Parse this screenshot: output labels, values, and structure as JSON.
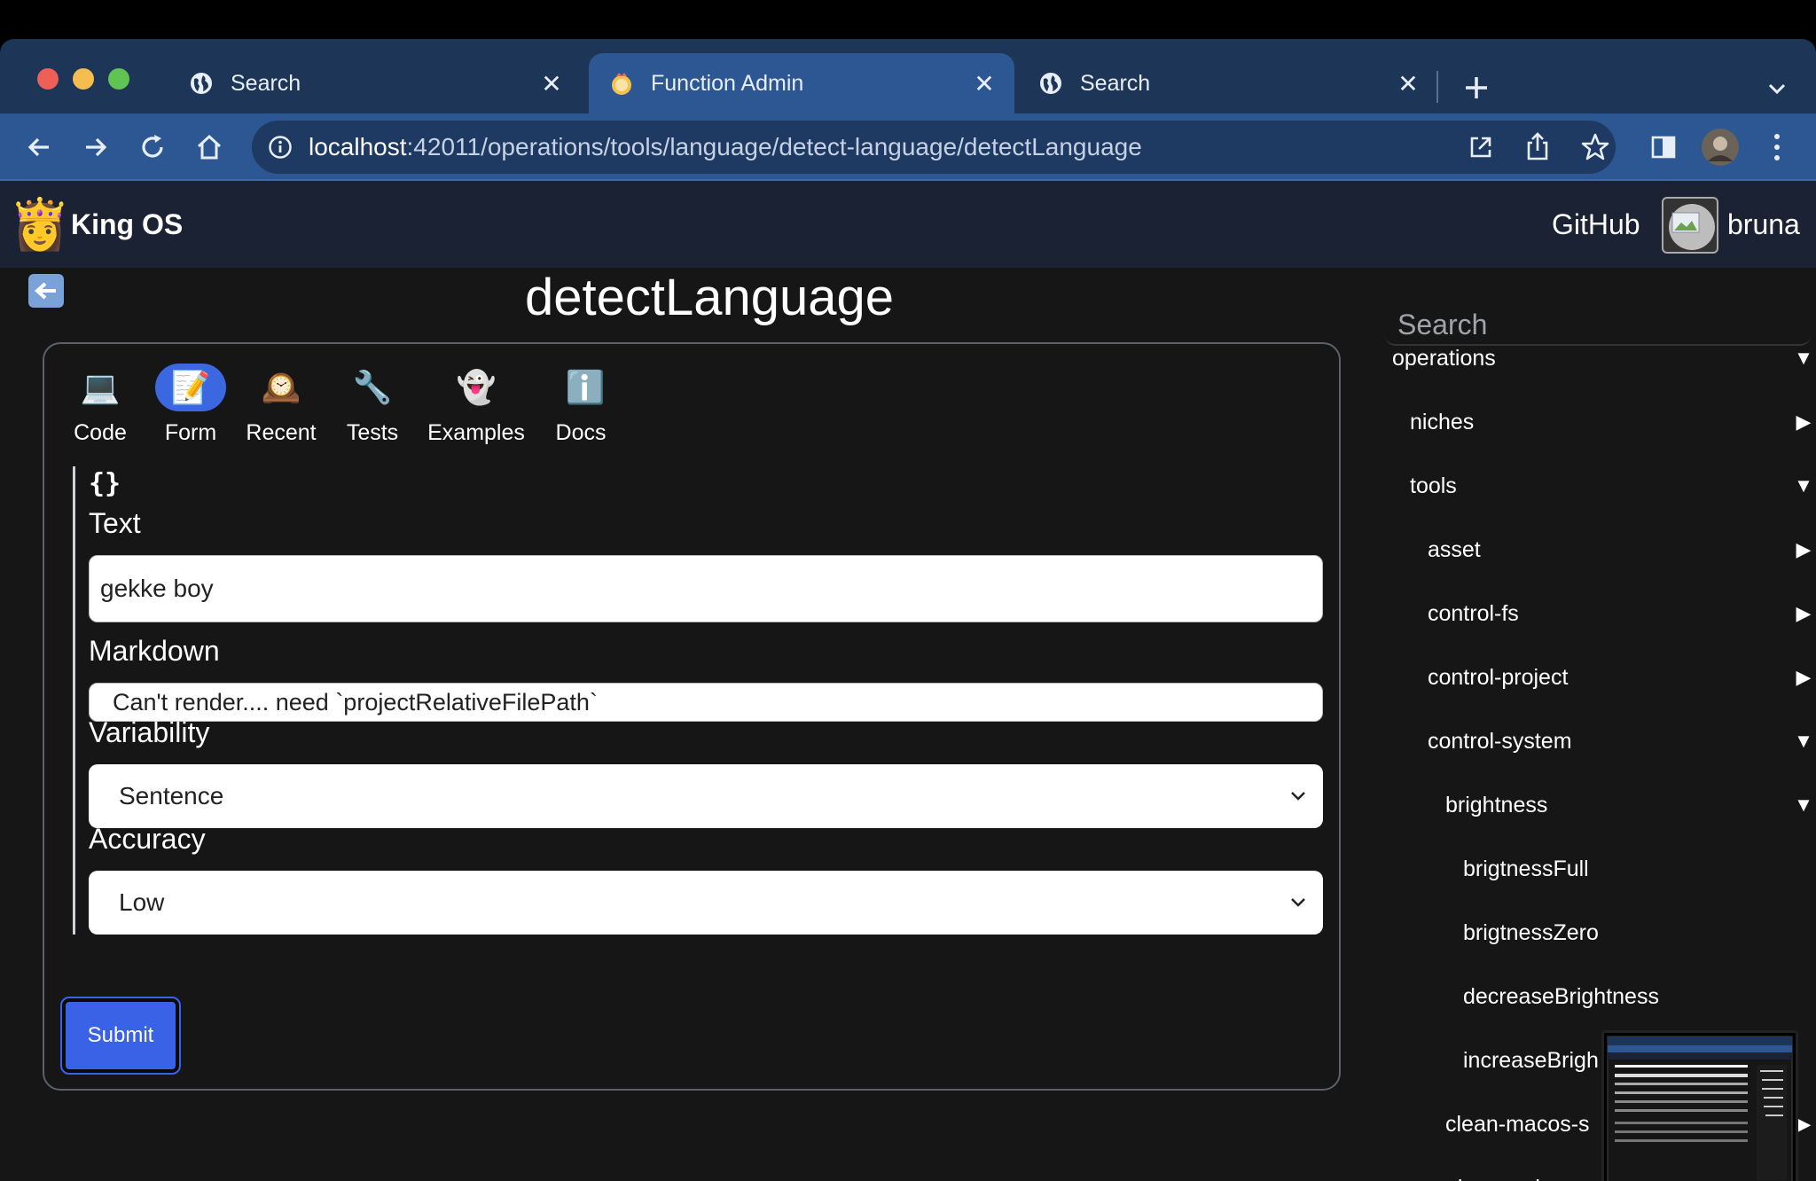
{
  "browser": {
    "tabs": [
      {
        "label": "Search",
        "favicon": "globe-icon"
      },
      {
        "label": "Function Admin",
        "favicon": "app-icon"
      },
      {
        "label": "Search",
        "favicon": "globe-icon"
      }
    ],
    "url_host": "localhost",
    "url_rest": ":42011/operations/tools/language/detect-language/detectLanguage"
  },
  "app": {
    "brand": "King OS",
    "brand_icon": "👸",
    "github": "GitHub",
    "username": "bruna"
  },
  "page": {
    "title": "detectLanguage"
  },
  "panel_tabs": [
    {
      "label": "Code",
      "icon": "💻"
    },
    {
      "label": "Form",
      "icon": "📝"
    },
    {
      "label": "Recent",
      "icon": "🕰️"
    },
    {
      "label": "Tests",
      "icon": "🔧"
    },
    {
      "label": "Examples",
      "icon": "👻"
    },
    {
      "label": "Docs",
      "icon": "ℹ️"
    }
  ],
  "form": {
    "object_symbol": "{}",
    "text_label": "Text",
    "text_value": "gekke boy",
    "markdown_label": "Markdown",
    "markdown_value": "Can't render.... need `projectRelativeFilePath`",
    "variability_label": "Variability",
    "variability_value": "Sentence",
    "accuracy_label": "Accuracy",
    "accuracy_value": "Low",
    "submit_label": "Submit"
  },
  "sidebar": {
    "search_placeholder": "Search",
    "items": [
      {
        "label": "operations",
        "expanded": true
      },
      {
        "label": "niches",
        "expanded": false
      },
      {
        "label": "tools",
        "expanded": true
      },
      {
        "label": "asset",
        "expanded": false
      },
      {
        "label": "control-fs",
        "expanded": false
      },
      {
        "label": "control-project",
        "expanded": false
      },
      {
        "label": "control-system",
        "expanded": true
      },
      {
        "label": "brightness",
        "expanded": true
      },
      {
        "label": "brigtnessFull"
      },
      {
        "label": "brigtnessZero"
      },
      {
        "label": "decreaseBrightness"
      },
      {
        "label": "increaseBrigh"
      },
      {
        "label": "clean-macos-s",
        "expanded": false
      },
      {
        "label": "play-music",
        "expanded": true
      }
    ]
  }
}
